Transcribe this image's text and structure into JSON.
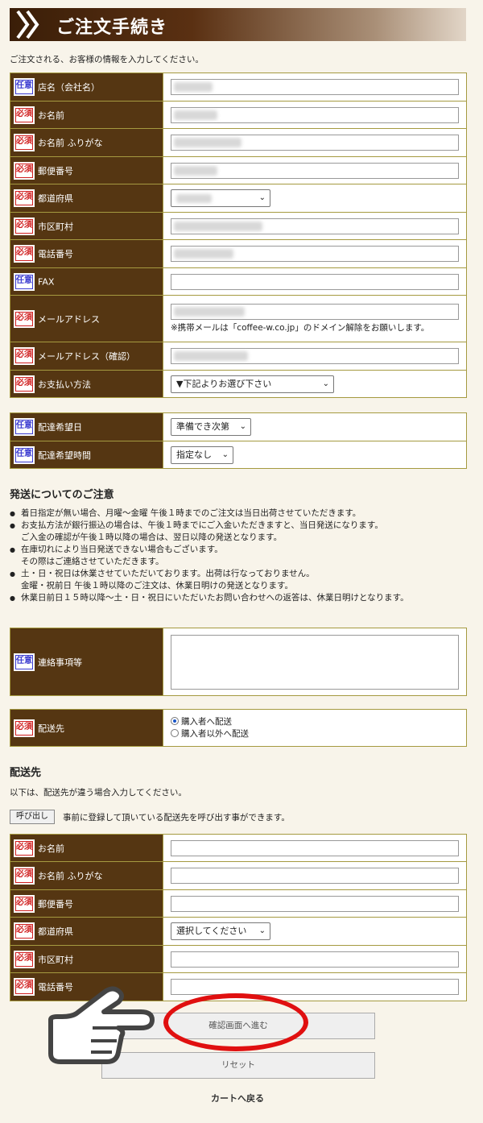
{
  "heading": {
    "title": "ご注文手続き"
  },
  "intro": "ご注文される、お客様の情報を入力してください。",
  "badges": {
    "required": "必須",
    "optional": "任意"
  },
  "customer": {
    "store_name": "店名（会社名）",
    "name": "お名前",
    "kana": "お名前 ふりがな",
    "postal": "郵便番号",
    "prefecture": "都道府県",
    "city": "市区町村",
    "phone": "電話番号",
    "fax": "FAX",
    "email": "メールアドレス",
    "email_note": "※携帯メールは「coffee-w.co.jp」のドメイン解除をお願いします。",
    "email_confirm": "メールアドレス（確認）",
    "payment": "お支払い方法",
    "payment_value": "▼下記よりお選び下さい"
  },
  "delivery": {
    "date": "配達希望日",
    "date_value": "準備でき次第",
    "time": "配達希望時間",
    "time_value": "指定なし"
  },
  "shipping_notice": {
    "title": "発送についてのご注意",
    "items": [
      {
        "text": "着日指定が無い場合、月曜～金曜 午後１時までのご注文は当日出荷させていただきます。",
        "sub": ""
      },
      {
        "text": "お支払方法が銀行振込の場合は、午後１時までにご入金いただきますと、当日発送になります。",
        "sub": "ご入金の確認が午後１時以降の場合は、翌日以降の発送となります。"
      },
      {
        "text": "在庫切れにより当日発送できない場合もございます。",
        "sub": "その際はご連絡させていただきます。"
      },
      {
        "text": "土・日・祝日は休業させていただいております。出荷は行なっておりません。",
        "sub": "金曜・祝前日 午後１時以降のご注文は、休業日明けの発送となります。"
      },
      {
        "text": "休業日前日１５時以降～土・日・祝日にいただいたお問い合わせへの返答は、休業日明けとなります。",
        "sub": ""
      }
    ]
  },
  "contact": {
    "label": "連絡事項等"
  },
  "destination": {
    "label": "配送先",
    "opt1": "購入者へ配送",
    "opt2": "購入者以外へ配送"
  },
  "shipping": {
    "title": "配送先",
    "desc": "以下は、配送先が違う場合入力してください。",
    "call_button": "呼び出し",
    "call_text": "事前に登録して頂いている配送先を呼び出す事ができます。",
    "name": "お名前",
    "kana": "お名前 ふりがな",
    "postal": "郵便番号",
    "prefecture": "都道府県",
    "prefecture_value": "選択してください",
    "city": "市区町村",
    "phone": "電話番号"
  },
  "buttons": {
    "confirm": "確認画面へ進む",
    "reset": "リセット",
    "cart": "カートへ戻る"
  }
}
